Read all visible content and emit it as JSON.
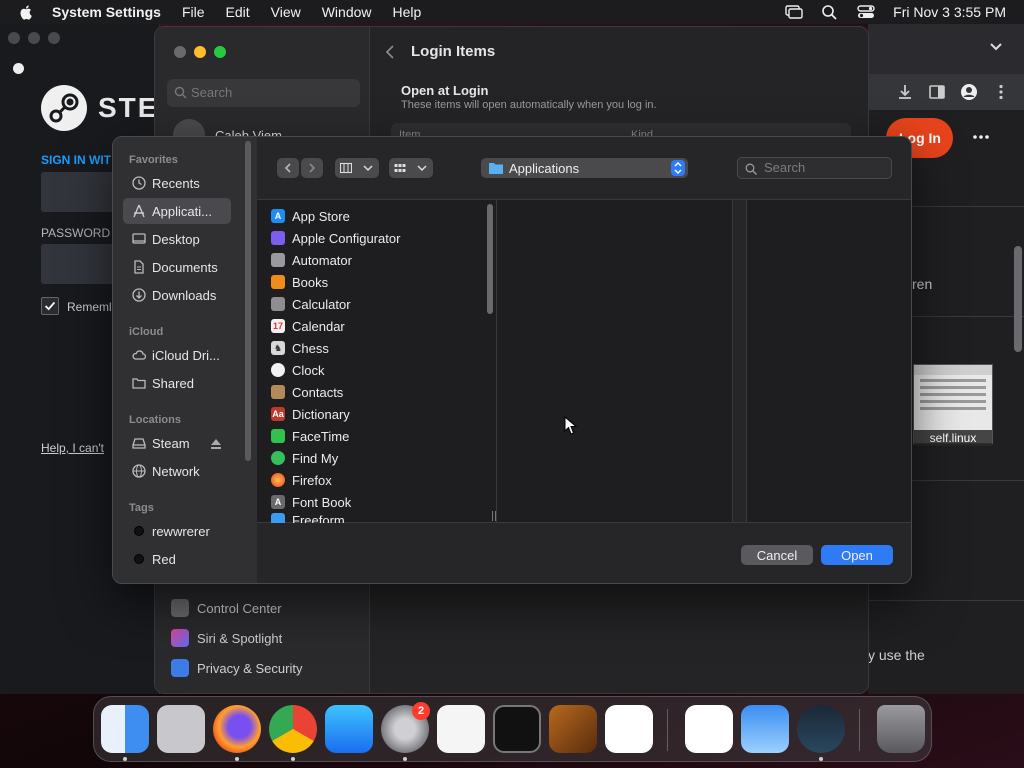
{
  "menubar": {
    "app_name": "System Settings",
    "items": [
      "File",
      "Edit",
      "View",
      "Window",
      "Help"
    ],
    "clock": "Fri Nov 3  3:55 PM"
  },
  "steam": {
    "logo_text": "STEA",
    "signin_label": "SIGN IN WIT",
    "password_label": "PASSWORD",
    "remember_label": "Rememl",
    "help_link": "Help, I can't"
  },
  "browser": {
    "login_label": "Log In",
    "partial_text_1": "ren",
    "thumb_label": "self.linux",
    "partial_text_2": "y use the"
  },
  "settings": {
    "search_placeholder": "Search",
    "user_name": "Caleb Viem",
    "header_title": "Login Items",
    "section_title": "Open at Login",
    "section_subtitle": "These items will open automatically when you log in.",
    "table_col_item": "Item",
    "table_col_kind": "Kind",
    "sidebar_bottom": [
      {
        "label": "Control Center"
      },
      {
        "label": "Siri & Spotlight"
      },
      {
        "label": "Privacy & Security"
      }
    ]
  },
  "panel": {
    "sidebar": {
      "favorites_header": "Favorites",
      "favorites": [
        "Recents",
        "Applicati...",
        "Desktop",
        "Documents",
        "Downloads"
      ],
      "icloud_header": "iCloud",
      "icloud": [
        "iCloud Dri...",
        "Shared"
      ],
      "locations_header": "Locations",
      "locations": [
        "Steam",
        "Network"
      ],
      "tags_header": "Tags",
      "tags": [
        "rewwrerer",
        "Red"
      ]
    },
    "location": "Applications",
    "search_placeholder": "Search",
    "files": [
      "App Store",
      "Apple Configurator",
      "Automator",
      "Books",
      "Calculator",
      "Calendar",
      "Chess",
      "Clock",
      "Contacts",
      "Dictionary",
      "FaceTime",
      "Find My",
      "Firefox",
      "Font Book",
      "Freeform"
    ],
    "cancel_label": "Cancel",
    "open_label": "Open"
  },
  "dock": {
    "settings_badge": "2"
  },
  "colors": {
    "accent": "#2e7bf6",
    "steam_link": "#1a9fff",
    "login_button": "#e8441c",
    "badge": "#ff3b30"
  }
}
